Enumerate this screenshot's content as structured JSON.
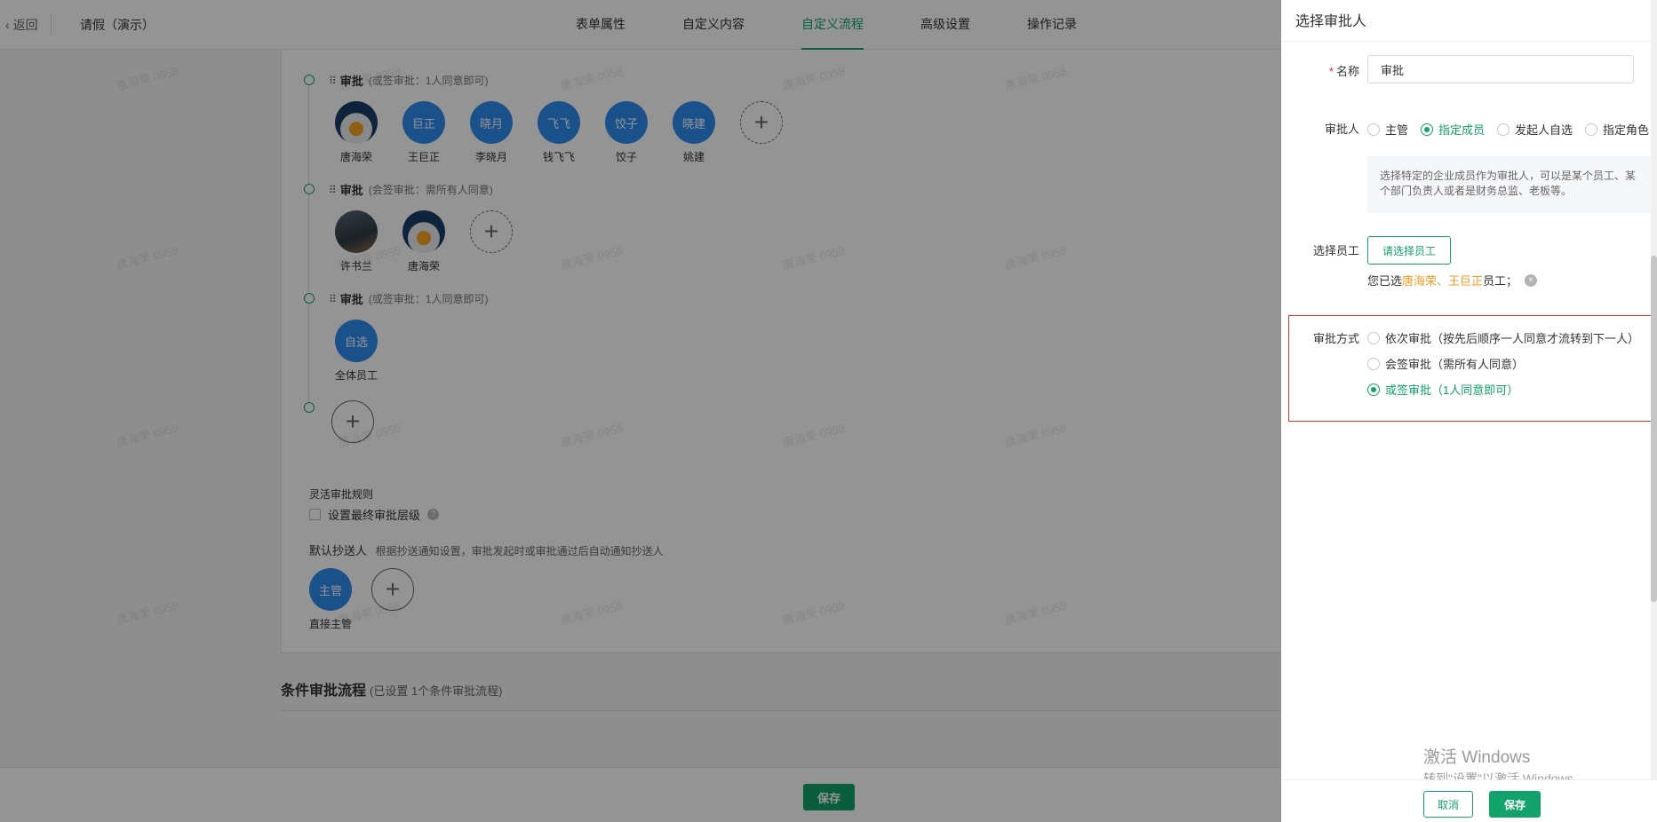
{
  "header": {
    "back_label": "返回",
    "doc_title": "请假（演示）",
    "tabs": [
      {
        "label": "表单属性"
      },
      {
        "label": "自定义内容"
      },
      {
        "label": "自定义流程"
      },
      {
        "label": "高级设置"
      },
      {
        "label": "操作记录"
      }
    ],
    "active_tab": "自定义流程"
  },
  "flow": {
    "nodes": [
      {
        "title": "审批",
        "note": "(或签审批：1人同意即可)",
        "members": [
          {
            "avatar": "",
            "name": "唐海荣"
          },
          {
            "avatar": "巨正",
            "name": "王巨正"
          },
          {
            "avatar": "晓月",
            "name": "李晓月"
          },
          {
            "avatar": "飞飞",
            "name": "钱飞飞"
          },
          {
            "avatar": "饺子",
            "name": "饺子"
          },
          {
            "avatar": "晓建",
            "name": "姚建"
          }
        ]
      },
      {
        "title": "审批",
        "note": "(会签审批：需所有人同意)",
        "members": [
          {
            "avatar": "",
            "name": "许书兰"
          },
          {
            "avatar": "",
            "name": "唐海荣"
          }
        ]
      },
      {
        "title": "审批",
        "note": "(或签审批：1人同意即可)",
        "members": [
          {
            "avatar": "自选",
            "name": "全体员工"
          }
        ]
      }
    ],
    "flex_rule_label": "灵活审批规则",
    "final_level_label": "设置最终审批层级",
    "cc_title": "默认抄送人",
    "cc_note": "根据抄送通知设置，审批发起时或审批通过后自动通知抄送人",
    "cc_member": {
      "avatar": "主管",
      "name": "直接主管"
    },
    "condition_title": "条件审批流程",
    "condition_note": "(已设置 1个条件审批流程)",
    "save_label": "保存"
  },
  "watermark_text": "唐海荣 0958",
  "drawer": {
    "title": "选择审批人",
    "name_label": "名称",
    "name_value": "审批",
    "approver_label": "审批人",
    "approver_options": [
      {
        "label": "主管",
        "selected": false
      },
      {
        "label": "指定成员",
        "selected": true
      },
      {
        "label": "发起人自选",
        "selected": false
      },
      {
        "label": "指定角色",
        "selected": false
      }
    ],
    "hint": "选择特定的企业成员作为审批人，可以是某个员工、某个部门负责人或者是财务总监、老板等。",
    "pick_label": "选择员工",
    "pick_button": "请选择员工",
    "chosen_prefix": "您已选",
    "chosen_names": "唐海荣、王巨正",
    "chosen_suffix": "员工；",
    "mode_label": "审批方式",
    "mode_options": [
      {
        "label": "依次审批（按先后顺序一人同意才流转到下一人）",
        "selected": false
      },
      {
        "label": "会签审批（需所有人同意）",
        "selected": false
      },
      {
        "label": "或签审批（1人同意即可）",
        "selected": true
      }
    ],
    "cancel_label": "取消",
    "save_label": "保存"
  },
  "system": {
    "activate_title": "激活 Windows",
    "activate_hint": "转到\"设置\"以激活 Windows。"
  },
  "colors": {
    "accent": "#12a26b",
    "highlight": "#f59a23",
    "outline": "#e6342e"
  }
}
